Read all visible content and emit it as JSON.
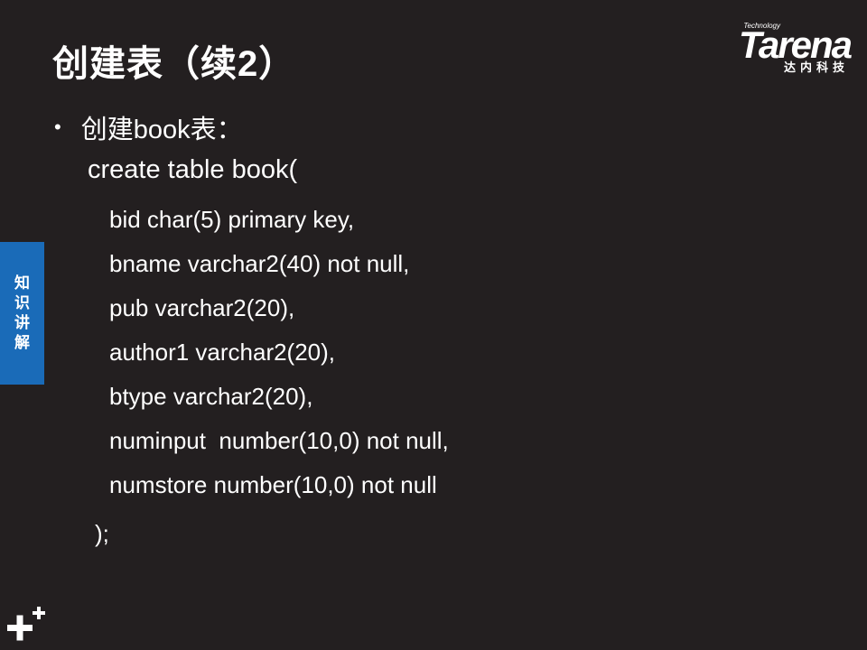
{
  "slide": {
    "title": "创建表（续2）",
    "bullet": "创建book表："
  },
  "logo": {
    "tagline_top": "Technology",
    "wordmark": "Tarena",
    "subtitle": "达内科技"
  },
  "side_tab": {
    "chars": [
      "知",
      "识",
      "讲",
      "解"
    ],
    "color": "#1a6bb8"
  },
  "code": {
    "lines": [
      "create table book(",
      "bid char(5) primary key,",
      "bname varchar2(40) not null,",
      "pub varchar2(20),",
      "author1 varchar2(20),",
      "btype varchar2(20),",
      "numinput  number(10,0) not null,",
      "numstore number(10,0) not null",
      ");"
    ]
  },
  "colors": {
    "background": "#231f20",
    "text": "#ffffff"
  },
  "icons": {
    "corner": "plus-icon"
  }
}
